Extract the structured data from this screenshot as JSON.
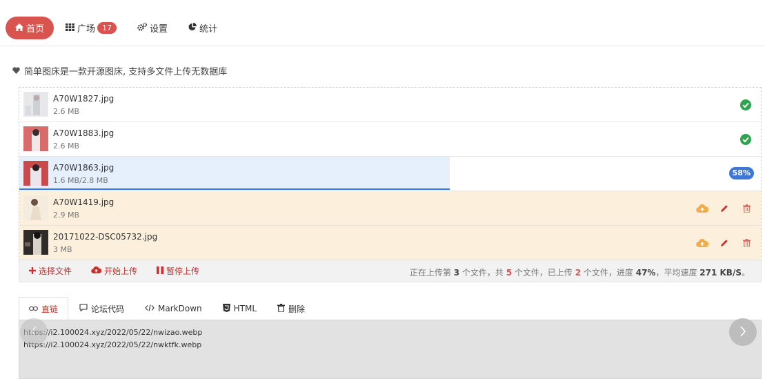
{
  "nav": {
    "items": [
      {
        "label": "首页",
        "icon": "home-icon"
      },
      {
        "label": "广场",
        "icon": "grid-icon",
        "badge": "17"
      },
      {
        "label": "设置",
        "icon": "gears-icon"
      },
      {
        "label": "统计",
        "icon": "pie-chart-icon"
      }
    ]
  },
  "intro": "简单图床是一款开源图床, 支持多文件上传无数据库",
  "files": [
    {
      "name": "A70W1827.jpg",
      "size": "2.6 MB",
      "state": "done"
    },
    {
      "name": "A70W1883.jpg",
      "size": "2.6 MB",
      "state": "done"
    },
    {
      "name": "A70W1863.jpg",
      "size": "1.6 MB/2.8 MB",
      "state": "uploading",
      "percent": "58%",
      "progress": 0.58
    },
    {
      "name": "A70W1419.jpg",
      "size": "2.9 MB",
      "state": "queued"
    },
    {
      "name": "20171022-DSC05732.jpg",
      "size": "3 MB",
      "state": "queued"
    }
  ],
  "toolbar": {
    "choose": "选择文件",
    "start": "开始上传",
    "pause": "暂停上传",
    "status": {
      "p1": "正在上传第 ",
      "current": "3",
      "p2": " 个文件，共 ",
      "total": "5",
      "p3": " 个文件，已上传 ",
      "uploaded": "2",
      "p4": " 个文件，进度 ",
      "progress": "47%",
      "p5": "，平均速度 ",
      "speed": "271 KB/S",
      "p6": "。"
    }
  },
  "tabs": [
    {
      "label": "直链",
      "icon": "link-icon"
    },
    {
      "label": "论坛代码",
      "icon": "comment-icon"
    },
    {
      "label": "MarkDown",
      "icon": "code-icon"
    },
    {
      "label": "HTML",
      "icon": "html5-icon"
    },
    {
      "label": "删除",
      "icon": "trash-icon"
    }
  ],
  "links": [
    "https://i2.100024.xyz/2022/05/22/nwizao.webp",
    "https://i2.100024.xyz/2022/05/22/nwktfk.webp"
  ],
  "colors": {
    "primary": "#d9534f",
    "accent": "#3c78d8",
    "success": "#2ea44f",
    "warning": "#f0ad4e"
  }
}
